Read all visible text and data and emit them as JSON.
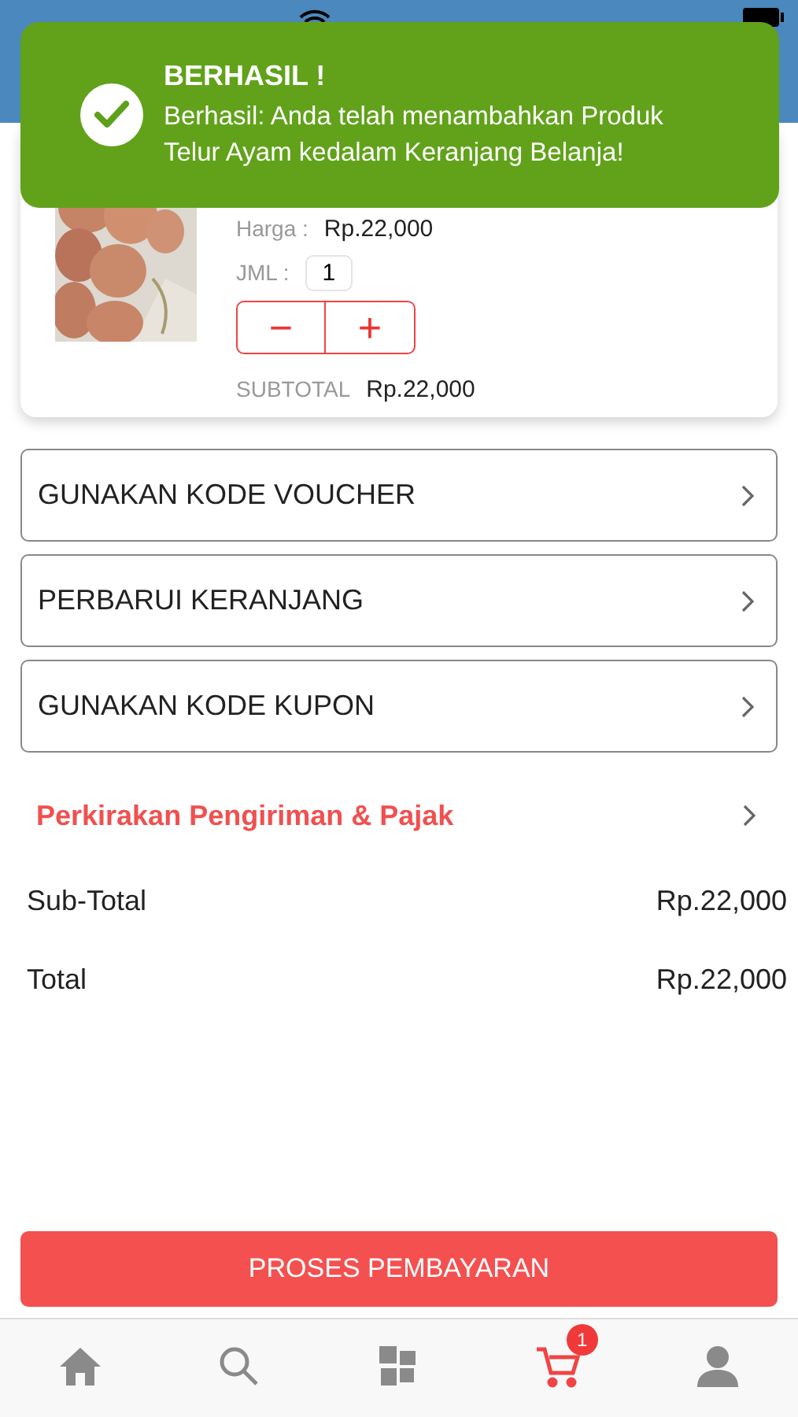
{
  "toast": {
    "title": "BERHASIL !",
    "message": "Berhasil: Anda telah menambahkan Produk Telur Ayam kedalam Keranjang Belanja!"
  },
  "cart_item": {
    "kind": "picture",
    "price_label": "Harga :",
    "price": "Rp.22,000",
    "qty_label": "JML :",
    "qty": "1",
    "minus": "−",
    "plus": "+",
    "subtotal_label": "SUBTOTAL",
    "subtotal": "Rp.22,000"
  },
  "actions": [
    {
      "label": "GUNAKAN KODE VOUCHER",
      "kind": "boxed"
    },
    {
      "label": "PERBARUI KERANJANG",
      "kind": "boxed"
    },
    {
      "label": "GUNAKAN KODE KUPON",
      "kind": "boxed"
    },
    {
      "label": "Perkirakan Pengiriman & Pajak",
      "kind": "link"
    }
  ],
  "totals": [
    {
      "label": "Sub-Total",
      "value": "Rp.22,000"
    },
    {
      "label": "Total",
      "value": "Rp.22,000"
    }
  ],
  "checkout_button": "PROSES PEMBAYARAN",
  "tab_bar": [
    {
      "kind": "home",
      "selected": false
    },
    {
      "kind": "search",
      "selected": false
    },
    {
      "kind": "grid",
      "selected": false
    },
    {
      "kind": "cart",
      "selected": true,
      "badge": "1"
    },
    {
      "kind": "user",
      "selected": false
    }
  ]
}
